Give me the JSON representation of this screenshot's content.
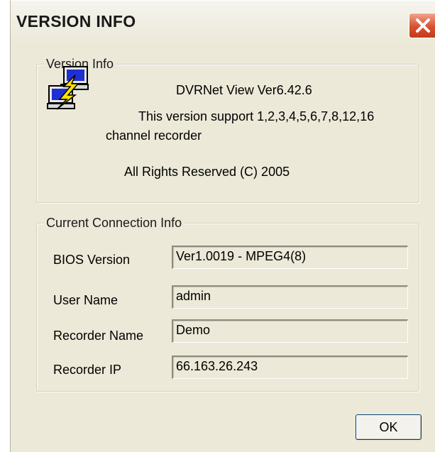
{
  "window": {
    "title": "VERSION INFO"
  },
  "version_group": {
    "legend": "Version Info",
    "product_line": "DVRNet View Ver6.42.6",
    "support_line_1": "This version support 1,2,3,4,5,6,7,8,12,16",
    "support_line_2": "channel recorder",
    "copyright": "All Rights Reserved (C) 2005",
    "icon": "network-computers-icon"
  },
  "connection_group": {
    "legend": "Current Connection Info",
    "rows": [
      {
        "label": "BIOS Version",
        "value": "Ver1.0019 - MPEG4(8)"
      },
      {
        "label": "User Name",
        "value": "admin"
      },
      {
        "label": "Recorder Name",
        "value": "Demo"
      },
      {
        "label": "Recorder IP",
        "value": "66.163.26.243"
      }
    ]
  },
  "buttons": {
    "ok_label": "OK",
    "close_icon": "close-icon"
  },
  "colors": {
    "dialog_bg": "#ece9d8",
    "close_button": "#d9502e",
    "button_border": "#003c74"
  }
}
